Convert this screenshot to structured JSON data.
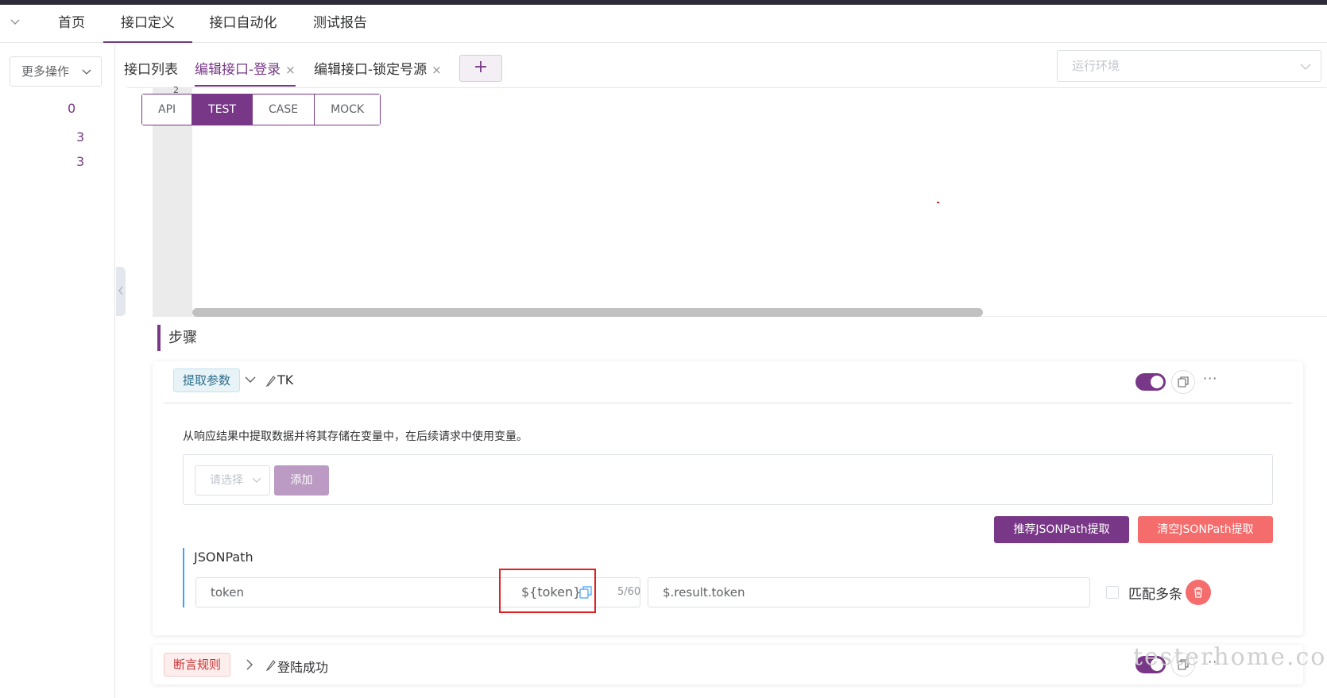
{
  "top_nav": {
    "tabs": [
      {
        "label": "首页"
      },
      {
        "label": "接口定义"
      },
      {
        "label": "接口自动化"
      },
      {
        "label": "测试报告"
      }
    ]
  },
  "left_panel": {
    "more_label": "更多操作",
    "counts": [
      "0",
      "3",
      "3"
    ]
  },
  "sub_tabs": {
    "tabs": [
      {
        "label": "接口列表"
      },
      {
        "label": "编辑接口-登录"
      },
      {
        "label": "编辑接口-锁定号源"
      }
    ],
    "close_glyph": "×",
    "add_glyph": "+",
    "env_placeholder": "运行环境"
  },
  "editor": {
    "line_number": "2",
    "modes": [
      "API",
      "TEST",
      "CASE",
      "MOCK"
    ]
  },
  "steps": {
    "title": "步骤",
    "extract_card": {
      "tag": "提取参数",
      "name": "TK",
      "description": "从响应结果中提取数据并将其存储在变量中，在后续请求中使用变量。",
      "select_placeholder": "请选择",
      "add_label": "添加",
      "recommend_label": "推荐JSONPath提取",
      "clear_label": "清空JSONPath提取",
      "section_label": "JSONPath",
      "var_name": "token",
      "var_ref": "${token}",
      "counter": "5/60",
      "json_path": "$.result.token",
      "match_multiple_label": "匹配多条",
      "more": "···"
    },
    "assert_card": {
      "tag": "断言规则",
      "name": "登陆成功",
      "more": "···"
    }
  },
  "watermark": "testerhome.com",
  "colors": {
    "accent": "#783887",
    "danger": "#f56c6c",
    "info_tag": "#2c6d8b"
  }
}
